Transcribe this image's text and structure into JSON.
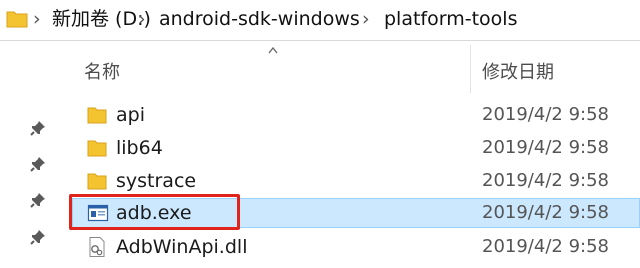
{
  "breadcrumb": {
    "parts": [
      "新加卷 (D:)",
      "android-sdk-windows",
      "platform-tools"
    ]
  },
  "columns": {
    "name": "名称",
    "date": "修改日期"
  },
  "files": [
    {
      "name": "api",
      "date": "2019/4/2 9:58",
      "type": "folder"
    },
    {
      "name": "lib64",
      "date": "2019/4/2 9:58",
      "type": "folder"
    },
    {
      "name": "systrace",
      "date": "2019/4/2 9:58",
      "type": "folder"
    },
    {
      "name": "adb.exe",
      "date": "2019/4/2 9:58",
      "type": "exe",
      "selected": true
    },
    {
      "name": "AdbWinApi.dll",
      "date": "2019/4/2 9:58",
      "type": "dll"
    }
  ],
  "colors": {
    "selection": "#cce8ff",
    "highlight_box": "#e0241b",
    "folder": "#f4c430"
  },
  "icons": [
    "folder-icon",
    "chevron-right-icon",
    "pin-icon",
    "sort-up-icon",
    "exe-icon",
    "dll-icon"
  ]
}
